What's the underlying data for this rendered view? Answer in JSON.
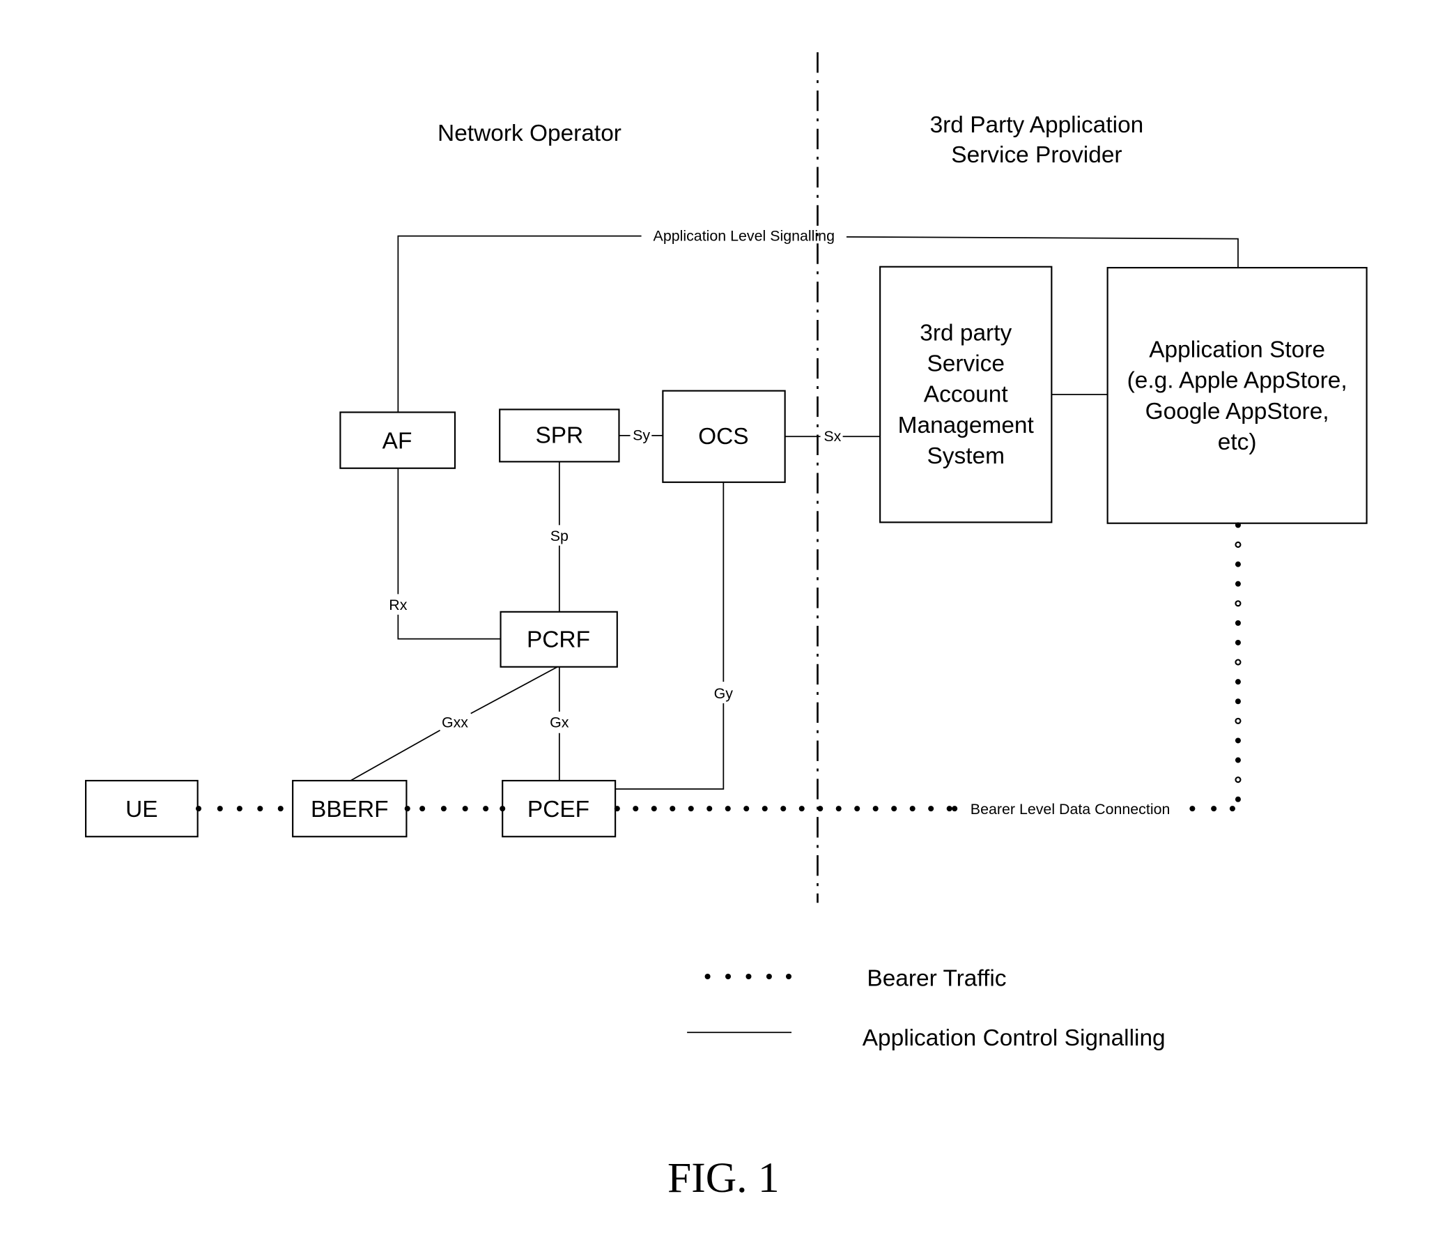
{
  "headers": {
    "left": "Network Operator",
    "right": [
      "3rd Party Application",
      "Service Provider"
    ]
  },
  "nodes": {
    "af": "AF",
    "spr": "SPR",
    "ocs": "OCS",
    "pcrf": "PCRF",
    "ue": "UE",
    "bberf": "BBERF",
    "pcef": "PCEF",
    "account_mgmt": [
      "3rd party",
      "Service",
      "Account",
      "Management",
      "System"
    ],
    "app_store": [
      "Application Store",
      "(e.g. Apple AppStore,",
      "Google AppStore,",
      "etc)"
    ]
  },
  "interfaces": {
    "sy": "Sy",
    "sx": "Sx",
    "sp": "Sp",
    "rx": "Rx",
    "gxx": "Gxx",
    "gx": "Gx",
    "gy": "Gy",
    "app_level_signalling": "Application Level Signalling",
    "bearer_level_data": "Bearer Level Data Connection"
  },
  "legend": {
    "bearer_traffic": "Bearer Traffic",
    "app_control_signalling": "Application Control Signalling"
  },
  "figure_caption": "FIG. 1"
}
